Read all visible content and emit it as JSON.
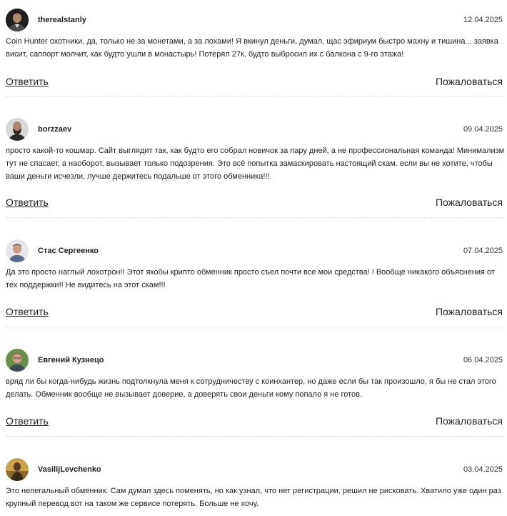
{
  "comments": [
    {
      "author": "therealstanly",
      "date": "12.04.2025",
      "text": "Coin Hunter охотники, да, только не за монетами, а за лохами! Я вкинул деньги, думал, щас эфириум быстро махну и тишина... заявка висит, саппорт молчит, как будто ушли в монастырь! Потерял 27к, будто выбросил их с балкона с 9-го этажа!",
      "reply_label": "Ответить",
      "report_label": "Пожаловаться",
      "avatar_icon": "user-avatar-icon"
    },
    {
      "author": "borzzaev",
      "date": "09.04.2025",
      "text": "просто какой-то кошмар. Сайт выглядит так, как будто его собрал новичок за пару дней, а не профессиональная команда! Минимализм тут не спасает, а наоборот, вызывает только подозрения. Это всё попытка замаскировать настоящий скам. если вы не хотите, чтобы ваши деньги исчезли, лучше держитесь подальше от этого обменника!!!",
      "reply_label": "Ответить",
      "report_label": "Пожаловаться",
      "avatar_icon": "user-avatar-icon"
    },
    {
      "author": "Стас Сергеенко",
      "date": "07.04.2025",
      "text": "Да это просто наглый лохотрон!! Этот якобы крипто обменник просто съел почти все мои средства! ! Вообще никакого объяснения от тех поддержки!! Не видитесь на этот скам!!!",
      "reply_label": "Ответить",
      "report_label": "Пожаловаться",
      "avatar_icon": "user-avatar-icon"
    },
    {
      "author": "Евгений Кузнецо",
      "date": "06.04.2025",
      "text": "вряд ли бы когда-нибудь жизнь подтолкнула меня к сотрудничеству с коинхантер, но даже если бы так произошло, я бы не стал этого делать. Обменник вообще не вызывает доверие, а доверять свои деньги кому попало я не готов.",
      "reply_label": "Ответить",
      "report_label": "Пожаловаться",
      "avatar_icon": "user-avatar-icon"
    },
    {
      "author": "VasilijLevchenko",
      "date": "03.04.2025",
      "text": "Это нелегальный обменник. Сам думал здесь поменять, но как узнал, что нет регистрации, решил не рисковать. Хватило уже один раз крупный перевод вот на таком же сервисе потерять. Больше не хочу.",
      "reply_label": "Ответить",
      "report_label": "Пожаловаться",
      "avatar_icon": "user-avatar-icon"
    }
  ],
  "colors": {
    "text": "#222222",
    "divider": "#dddddd",
    "background": "#ffffff"
  }
}
